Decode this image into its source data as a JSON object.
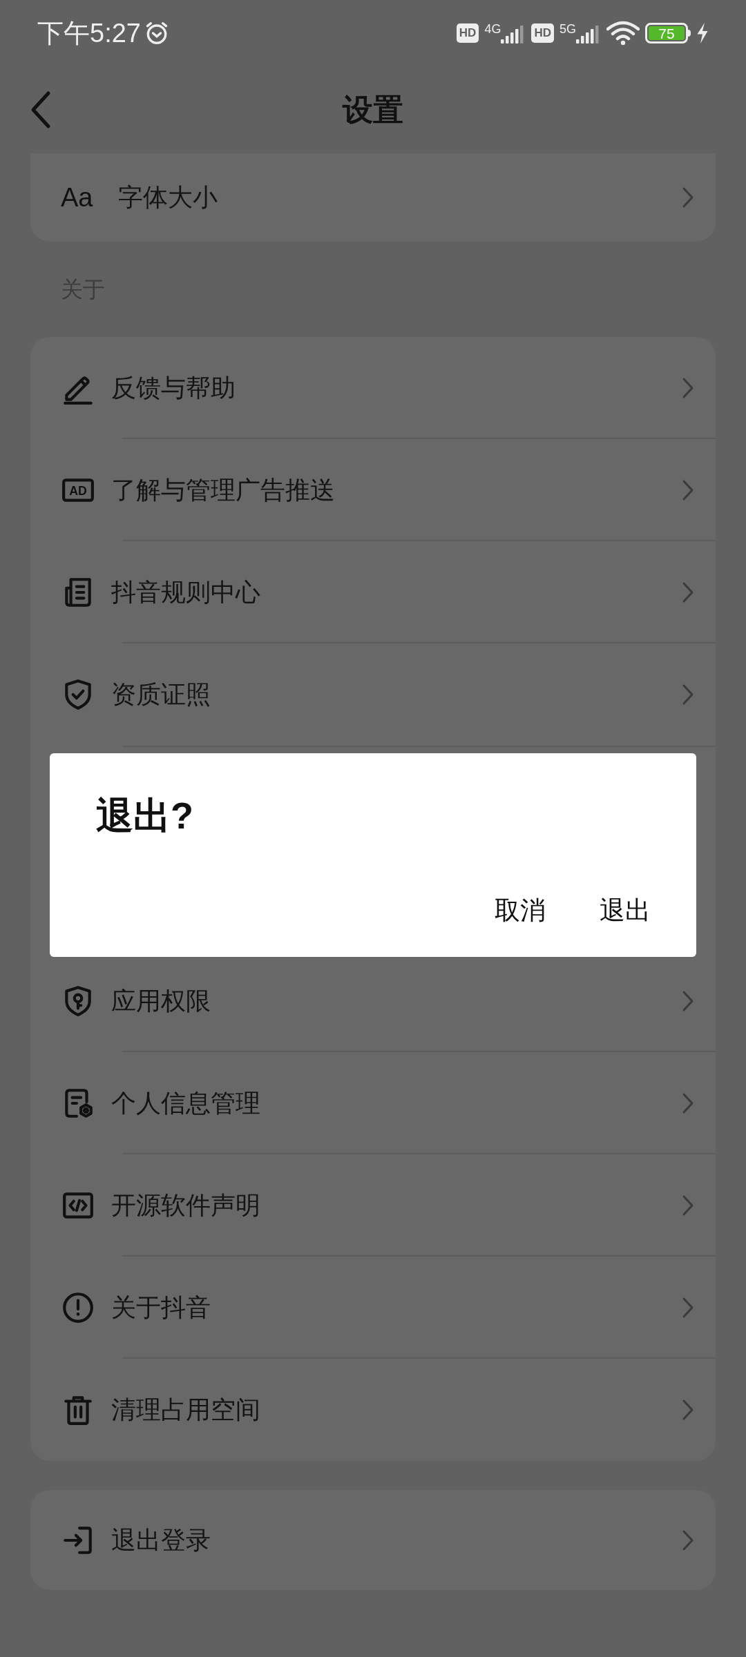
{
  "status_bar": {
    "time": "下午5:27",
    "hd_badges": [
      "HD",
      "HD"
    ],
    "network_1": "4G",
    "network_2": "5G",
    "battery": "75",
    "charging": true
  },
  "header": {
    "title": "设置"
  },
  "top_card": {
    "items": [
      {
        "label": "字体大小",
        "icon_text": "Aa"
      }
    ]
  },
  "section": {
    "label": "关于",
    "items": [
      {
        "label": "反馈与帮助"
      },
      {
        "label": "了解与管理广告推送",
        "icon_text": "AD"
      },
      {
        "label": "抖音规则中心"
      },
      {
        "label": "资质证照"
      },
      {
        "label": "应用权限"
      },
      {
        "label": "个人信息管理"
      },
      {
        "label": "开源软件声明"
      },
      {
        "label": "关于抖音"
      },
      {
        "label": "清理占用空间"
      }
    ]
  },
  "logout_card": {
    "items": [
      {
        "label": "退出登录"
      }
    ]
  },
  "dialog": {
    "title": "退出?",
    "buttons": [
      "取消",
      "退出"
    ]
  }
}
